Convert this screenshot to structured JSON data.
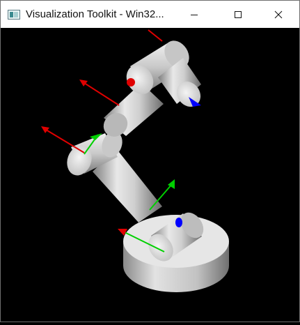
{
  "window": {
    "title": "Visualization Toolkit - Win32...",
    "controls": {
      "minimize_icon": "minimize-icon",
      "maximize_icon": "maximize-icon",
      "close_icon": "close-icon"
    }
  },
  "scene": {
    "background": "#000000",
    "object_color": "#d9d9d9",
    "axis_colors": {
      "x": "#e00000",
      "y": "#00d000",
      "z": "#0000ff"
    }
  }
}
